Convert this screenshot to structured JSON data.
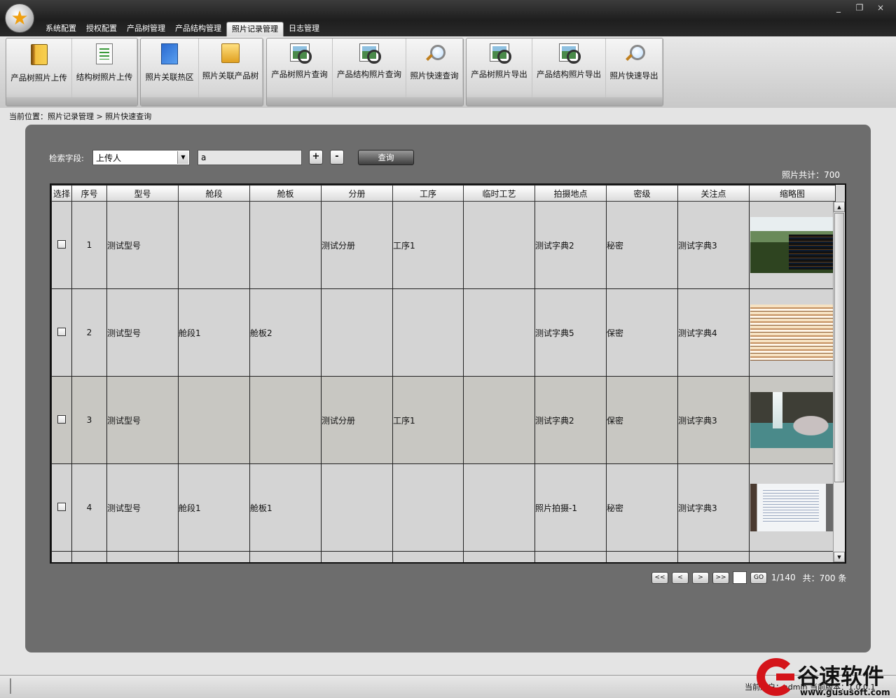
{
  "window": {
    "minimize": "_",
    "restore": "❐",
    "close": "×"
  },
  "menu_tabs": [
    "系统配置",
    "授权配置",
    "产品树管理",
    "产品结构管理",
    "照片记录管理",
    "日志管理"
  ],
  "ribbon_groups": [
    {
      "buttons": [
        {
          "label": "产品树照片上传",
          "icon": "book-icon"
        },
        {
          "label": "结构树照片上传",
          "icon": "document-list-icon"
        }
      ]
    },
    {
      "buttons": [
        {
          "label": "照片关联热区",
          "icon": "blue-document-icon"
        },
        {
          "label": "照片关联产品树",
          "icon": "folder-icon"
        }
      ]
    },
    {
      "buttons": [
        {
          "label": "产品树照片查询",
          "icon": "photo-search-icon"
        },
        {
          "label": "产品结构照片查询",
          "icon": "photo-search-icon"
        },
        {
          "label": "照片快速查询",
          "icon": "magnifier-icon"
        }
      ]
    },
    {
      "buttons": [
        {
          "label": "产品树照片导出",
          "icon": "photo-search-icon"
        },
        {
          "label": "产品结构照片导出",
          "icon": "photo-search-icon"
        },
        {
          "label": "照片快速导出",
          "icon": "magnifier-icon"
        }
      ]
    }
  ],
  "breadcrumb": "当前位置：照片记录管理 > 照片快速查询",
  "search": {
    "label": "检索字段:",
    "field_value": "上传人",
    "query_value": "a",
    "add_label": "+",
    "remove_label": "-",
    "query_button": "查询"
  },
  "total_label": "照片共计：700",
  "table": {
    "columns": [
      "选择",
      "序号",
      "型号",
      "舱段",
      "舱板",
      "分册",
      "工序",
      "临时工艺",
      "拍摄地点",
      "密级",
      "关注点",
      "缩略图"
    ],
    "rows": [
      {
        "no": "1",
        "model": "测试型号",
        "section": "",
        "panel": "",
        "volume": "测试分册",
        "process": "工序1",
        "temp": "",
        "location": "测试字典2",
        "secret": "秘密",
        "focus": "测试字典3",
        "thumb": "t1"
      },
      {
        "no": "2",
        "model": "测试型号",
        "section": "舱段1",
        "panel": "舱板2",
        "volume": "",
        "process": "",
        "temp": "",
        "location": "测试字典5",
        "secret": "保密",
        "focus": "测试字典4",
        "thumb": "t2"
      },
      {
        "no": "3",
        "model": "测试型号",
        "section": "",
        "panel": "",
        "volume": "测试分册",
        "process": "工序1",
        "temp": "",
        "location": "测试字典2",
        "secret": "保密",
        "focus": "测试字典3",
        "thumb": "t3"
      },
      {
        "no": "4",
        "model": "测试型号",
        "section": "舱段1",
        "panel": "舱板1",
        "volume": "",
        "process": "",
        "temp": "",
        "location": "照片拍摄-1",
        "secret": "秘密",
        "focus": "测试字典3",
        "thumb": "t4"
      }
    ]
  },
  "pager": {
    "first": "<<",
    "prev": "<",
    "next": ">",
    "last": ">>",
    "go": "GO",
    "info": "1/140",
    "total": "共：700 条"
  },
  "status": {
    "left": "当前用户：admin  当前版本：1.0.0.1"
  },
  "watermark": {
    "brand": "谷速软件",
    "url": "www.gususoft.com"
  }
}
